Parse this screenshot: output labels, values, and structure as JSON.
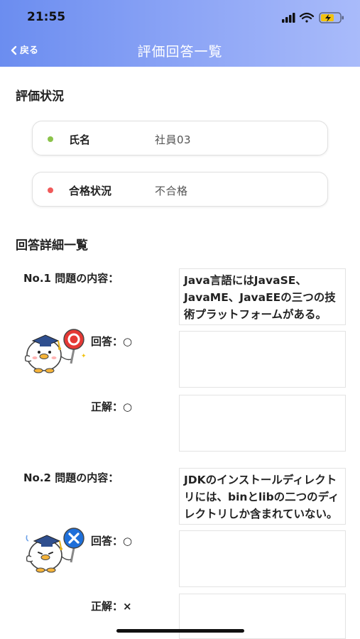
{
  "status": {
    "time": "21:55"
  },
  "nav": {
    "back_label": "戻る",
    "title": "評価回答一覧"
  },
  "eval_section": {
    "title": "評価状況",
    "items": [
      {
        "label": "氏名",
        "value": "社員03",
        "dot_color": "#8bc34a"
      },
      {
        "label": "合格状況",
        "value": "不合格",
        "dot_color": "#f05a5a"
      }
    ]
  },
  "detail_section": {
    "title": "回答詳細一覧",
    "questions": [
      {
        "no_label": "No.1 問題の内容：",
        "content": "Java言語にはJavaSE、JavaME、JavaEEの三つの技術プラットフォームがある。",
        "answer_label": "回答：○",
        "correct_label": "正解：○",
        "result": "correct"
      },
      {
        "no_label": "No.2 問題の内容：",
        "content": "JDKのインストールディレクトリには、binとlibの二つのディレクトリしか含まれていない。",
        "answer_label": "回答：○",
        "correct_label": "正解：×",
        "result": "wrong"
      }
    ]
  },
  "colors": {
    "header_start": "#6b8df0",
    "header_end": "#a9bbfa",
    "correct_mark": "#e53935",
    "wrong_mark": "#1e6fd9"
  }
}
